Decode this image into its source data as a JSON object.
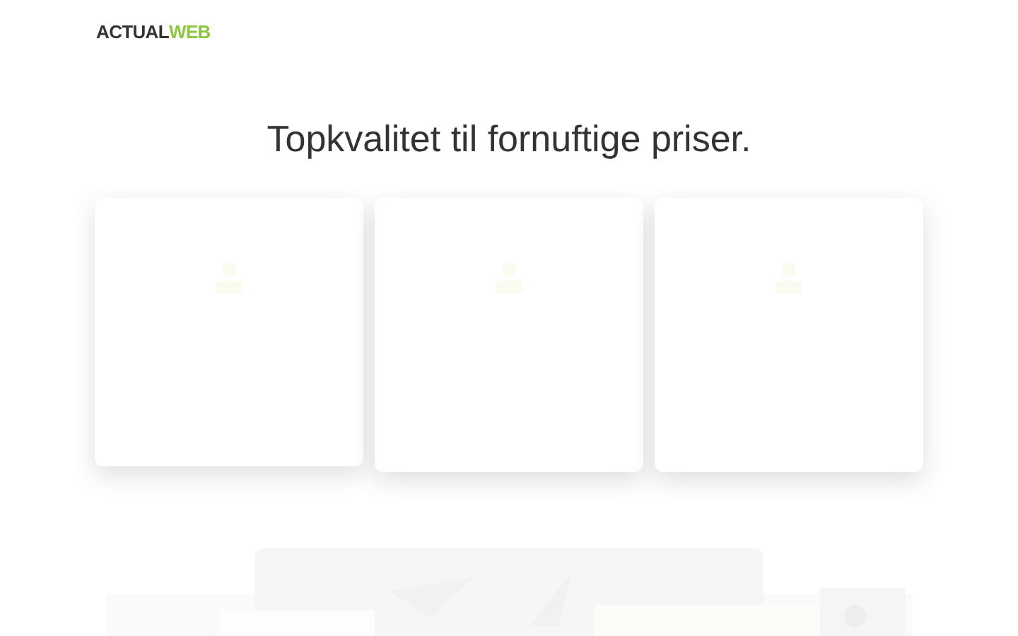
{
  "logo": {
    "first": "ACTUAL",
    "second": "WEB"
  },
  "headline": "Topkvalitet til fornuftige priser."
}
